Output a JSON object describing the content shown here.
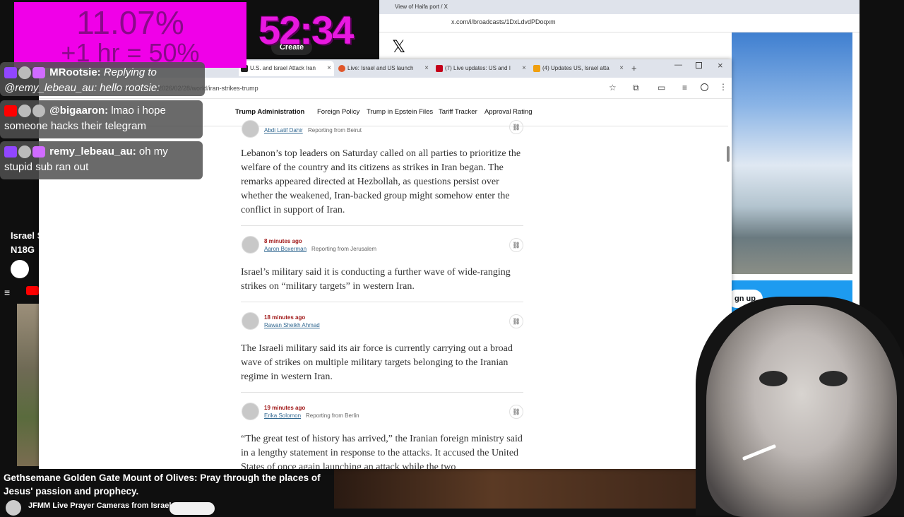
{
  "overlay": {
    "stat_pct": "11.07%",
    "stat_sub": "+1 hr = 50%",
    "timer": "52:34"
  },
  "chat": [
    {
      "platform": "twitch",
      "name": "MRootsie:",
      "msg": "Replying to @remy_lebeau_au: hello rootsie:"
    },
    {
      "platform": "youtube",
      "name": "@bigaaron:",
      "msg": "lmao i hope someone hacks their telegram"
    },
    {
      "platform": "twitch",
      "name": "remy_lebeau_au:",
      "msg": "oh my stupid sub ran out"
    }
  ],
  "youtube_bg": {
    "create_label": "Create",
    "side_text_1": "Israel S",
    "side_text_2": "N18G",
    "bottom_title": "Gethsemane Golden Gate Mount of Olives: Pray through the places of Jesus' passion and prophecy.",
    "bottom_channel": "JFMM Live Prayer Cameras from Israel"
  },
  "x_window": {
    "tab_title": "View of Haifa port / X",
    "url": "x.com/i/broadcasts/1DxLdvdPDoqxm",
    "signup_label": "gn up"
  },
  "browser": {
    "tabs": [
      {
        "title": "U.S. and Israel Attack Iran",
        "active": true,
        "color": "#222222"
      },
      {
        "title": "Live: Israel and US launch",
        "active": false,
        "color": "#e0562a"
      },
      {
        "title": "(7) Live updates: US and I",
        "active": false,
        "color": "#c4001a"
      },
      {
        "title": "(4) Updates US, Israel atta",
        "active": false,
        "color": "#f0a010"
      }
    ],
    "url": "nytimes.com/live/2026/02/28/world/iran-strikes-trump"
  },
  "nav": [
    "Trump Administration",
    "Foreign Policy",
    "Trump in Epstein Files",
    "Tariff Tracker",
    "Approval Rating"
  ],
  "posts": [
    {
      "time": "",
      "author": "Abdi Latif Dahir",
      "location": "Reporting from Beirut",
      "body": "Lebanon’s top leaders on Saturday called on all parties to prioritize the welfare of the country and its citizens as strikes in Iran began. The remarks appeared directed at Hezbollah, as questions persist over whether the weakened, Iran-backed group might somehow enter the conflict in support of Iran."
    },
    {
      "time": "8 minutes ago",
      "author": "Aaron Boxerman",
      "location": "Reporting from Jerusalem",
      "body": "Israel’s military said it is conducting a further wave of wide-ranging strikes on “military targets” in western Iran."
    },
    {
      "time": "18 minutes ago",
      "author": "Rawan Sheikh Ahmad",
      "location": "",
      "body": "The Israeli military said its air force is currently carrying out a broad wave of strikes on multiple military targets belonging to the Iranian regime in western Iran."
    },
    {
      "time": "19 minutes ago",
      "author": "Erika Solomon",
      "location": "Reporting from Berlin",
      "body": "“The great test of history has arrived,” the Iranian foreign ministry said in a lengthy statement in response to the attacks. It accused the United States of once again launching an attack while the two"
    }
  ]
}
